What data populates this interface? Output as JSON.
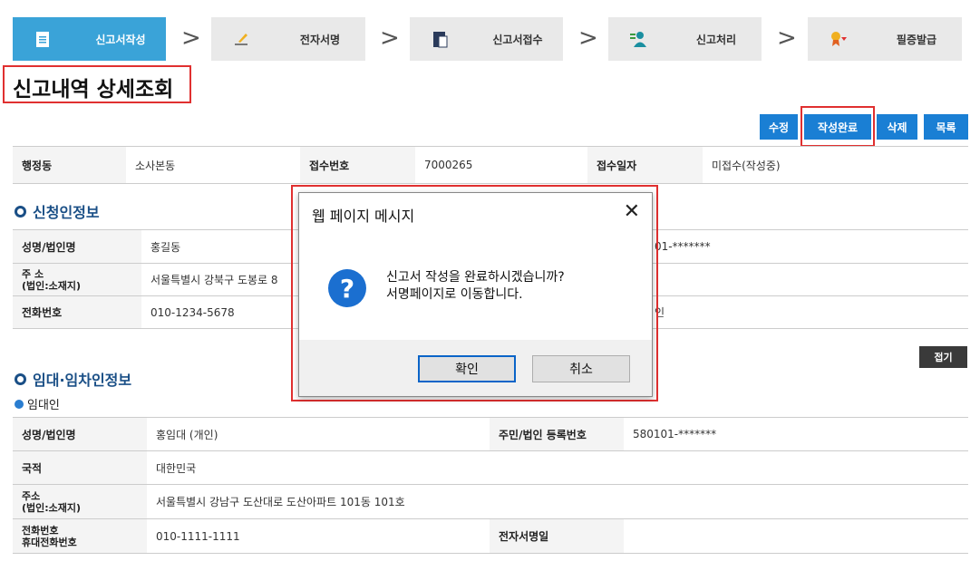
{
  "steps": [
    {
      "label": "신고서작성",
      "icon": "document-icon"
    },
    {
      "label": "전자서명",
      "icon": "pen-sign-icon"
    },
    {
      "label": "신고서접수",
      "icon": "file-submit-icon"
    },
    {
      "label": "신고처리",
      "icon": "person-process-icon"
    },
    {
      "label": "필증발급",
      "icon": "certificate-icon"
    }
  ],
  "step_arrow": ">",
  "page_title": "신고내역 상세조회",
  "toolbar": {
    "edit": "수정",
    "complete": "작성완료",
    "delete": "삭제",
    "list": "목록"
  },
  "summary": {
    "dong_label": "행정동",
    "dong_value": "소사본동",
    "receipt_no_label": "접수번호",
    "receipt_no_value": "7000265",
    "receipt_date_label": "접수일자",
    "receipt_date_value": "미접수(작성중)"
  },
  "applicant": {
    "section_title": "신청인정보",
    "name_label": "성명/법인명",
    "name_value": "홍길동",
    "id_value_partial": "01-*******",
    "addr_label_1": "주    소",
    "addr_label_2": "(법인:소재지)",
    "addr_value": "서울특별시 강북구 도봉로 8",
    "phone_label": "전화번호",
    "phone_value": "010-1234-5678",
    "right_partial": "인"
  },
  "lease": {
    "section_title": "임대·임차인정보",
    "fold": "접기",
    "lessor_title": "임대인",
    "name_label": "성명/법인명",
    "name_value": "홍임대 (개인)",
    "id_label": "주민/법인 등록번호",
    "id_value": "580101-*******",
    "nation_label": "국적",
    "nation_value": "대한민국",
    "addr_label_1": "주소",
    "addr_label_2": "(법인:소재지)",
    "addr_value": "서울특별시 강남구 도산대로 도산아파트 101동 101호",
    "phone_label_1": "전화번호",
    "phone_label_2": "휴대전화번호",
    "phone_value": "010-1111-1111",
    "esign_label": "전자서명일",
    "esign_value": ""
  },
  "dialog": {
    "title": "웹 페이지 메시지",
    "close": "✕",
    "icon_glyph": "?",
    "line1": "신고서 작성을 완료하시겠습니까?",
    "line2": "서명페이지로 이동합니다.",
    "ok": "확인",
    "cancel": "취소"
  },
  "colors": {
    "accent": "#3aa3d8",
    "button_blue": "#1a7fd4",
    "highlight_red": "#e03030",
    "section_navy": "#1a4f86"
  }
}
